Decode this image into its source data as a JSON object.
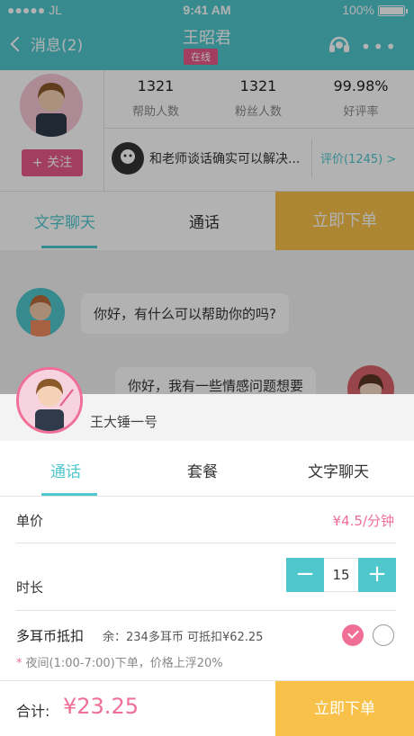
{
  "status_bar": {
    "carrier": "●●●●● JL",
    "time": "9:41 AM",
    "battery": "100%"
  },
  "nav": {
    "back_label": "消息(2)",
    "title": "王昭君",
    "status_badge": "在线"
  },
  "profile": {
    "follow_label": "+ 关注",
    "stats": [
      {
        "value": "1321",
        "label": "帮助人数"
      },
      {
        "value": "1321",
        "label": "粉丝人数"
      },
      {
        "value": "99.98%",
        "label": "好评率"
      }
    ],
    "review_snippet": "和老师谈话确实可以解决...",
    "review_link": "评价(1245) >"
  },
  "page_tabs": {
    "text_chat": "文字聊天",
    "call": "通话",
    "order": "立即下单"
  },
  "chat": {
    "msg_left": "你好，有什么可以帮助你的吗?",
    "msg_right": "你好，我有一些情感问题想要"
  },
  "sheet": {
    "advisor_name": "王大锤一号",
    "tabs": [
      "通话",
      "套餐",
      "文字聊天"
    ],
    "unit_price_label": "单价",
    "unit_price_value": "¥4.5/分钟",
    "duration_label": "时长",
    "duration_value": "15",
    "coin_label": "多耳币抵扣",
    "coin_detail": "余：234多耳币 可抵扣¥62.25",
    "night_note": "夜间(1:00-7:00)下单，价格上浮20%",
    "total_label": "合计:",
    "total_value": "¥23.25",
    "order_button": "立即下单"
  },
  "colors": {
    "accent": "#4fc7cd",
    "pink": "#ef6f97",
    "yellow": "#f7c14a"
  },
  "icons": [
    "back-chevron-icon",
    "headset-icon",
    "more-icon",
    "minus-icon",
    "plus-icon",
    "check-icon"
  ]
}
